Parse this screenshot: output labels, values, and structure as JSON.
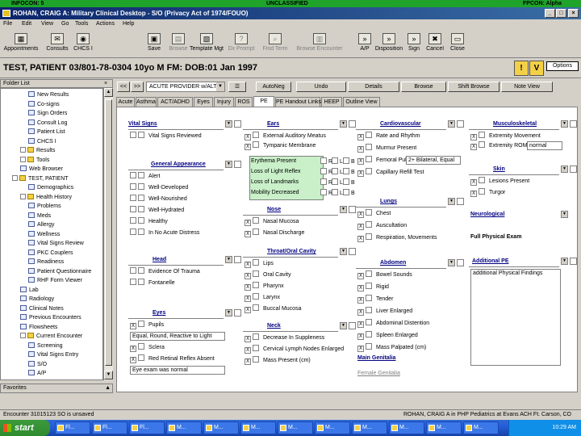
{
  "classification": {
    "left": "INFOCON: 5",
    "center": "UNCLASSIFIED",
    "right": "FPCON: Alpha"
  },
  "window": {
    "title": "ROHAN, CRAIG A: Military Clinical Desktop - S/O (Privacy Act of 1974/FOUO)",
    "buttons": [
      "_",
      "□",
      "×"
    ]
  },
  "menu": [
    "File",
    "Edit",
    "View",
    "Go",
    "Tools",
    "Actions",
    "Help"
  ],
  "toolbar": {
    "left": [
      {
        "label": "Appointments",
        "icon": "calendar-icon"
      },
      {
        "label": "Consults",
        "icon": "consult-icon"
      },
      {
        "label": "CHCS I",
        "icon": "chcs-icon"
      }
    ],
    "right": [
      {
        "label": "Save",
        "icon": "save-icon",
        "enabled": true
      },
      {
        "label": "Browse",
        "icon": "browse-icon",
        "enabled": false
      },
      {
        "label": "Template Mgt",
        "icon": "template-icon",
        "enabled": true
      },
      {
        "label": "Dx Prompt",
        "icon": "dx-icon",
        "enabled": false
      },
      {
        "label": "Find Term",
        "icon": "find-icon",
        "enabled": false
      },
      {
        "label": "Browse Encounter",
        "icon": "browse-encounter-icon",
        "enabled": false
      },
      {
        "label": "A/P",
        "icon": "ap-icon",
        "enabled": true
      },
      {
        "label": "Disposition",
        "icon": "disposition-icon",
        "enabled": true
      },
      {
        "label": "Sign",
        "icon": "sign-icon",
        "enabled": true
      },
      {
        "label": "Cancel",
        "icon": "cancel-icon",
        "enabled": true
      },
      {
        "label": "Close",
        "icon": "close-doc-icon",
        "enabled": true
      }
    ]
  },
  "patient": {
    "banner": "TEST, PATIENT 03/801-78-0304 10yo M FM: DOB:01 Jan 1997",
    "options_label": "Options"
  },
  "folder": {
    "header": "Folder List",
    "favorites": "Favorites",
    "items": [
      {
        "label": "New Results",
        "depth": 3,
        "type": "doc"
      },
      {
        "label": "Co-signs",
        "depth": 3,
        "type": "doc"
      },
      {
        "label": "Sign Orders",
        "depth": 3,
        "type": "doc"
      },
      {
        "label": "Consult Log",
        "depth": 3,
        "type": "doc"
      },
      {
        "label": "Patient List",
        "depth": 3,
        "type": "doc"
      },
      {
        "label": "CHCS I",
        "depth": 3,
        "type": "doc"
      },
      {
        "label": "Results",
        "depth": 2,
        "type": "fold"
      },
      {
        "label": "Tools",
        "depth": 2,
        "type": "fold"
      },
      {
        "label": "Web Browser",
        "depth": 2,
        "type": "doc"
      },
      {
        "label": "TEST, PATIENT",
        "depth": 1,
        "type": "fold"
      },
      {
        "label": "Demographics",
        "depth": 3,
        "type": "doc"
      },
      {
        "label": "Health History",
        "depth": 2,
        "type": "fold"
      },
      {
        "label": "Problems",
        "depth": 3,
        "type": "doc"
      },
      {
        "label": "Meds",
        "depth": 3,
        "type": "doc"
      },
      {
        "label": "Allergy",
        "depth": 3,
        "type": "doc"
      },
      {
        "label": "Wellness",
        "depth": 3,
        "type": "doc"
      },
      {
        "label": "Vital Signs Review",
        "depth": 3,
        "type": "doc"
      },
      {
        "label": "PKC Couplers",
        "depth": 3,
        "type": "doc"
      },
      {
        "label": "Readiness",
        "depth": 3,
        "type": "doc"
      },
      {
        "label": "Patient Questionnaire",
        "depth": 3,
        "type": "doc"
      },
      {
        "label": "RHF Form Viewer",
        "depth": 3,
        "type": "doc"
      },
      {
        "label": "Lab",
        "depth": 2,
        "type": "doc"
      },
      {
        "label": "Radiology",
        "depth": 2,
        "type": "doc"
      },
      {
        "label": "Clinical Notes",
        "depth": 2,
        "type": "doc"
      },
      {
        "label": "Previous Encounters",
        "depth": 2,
        "type": "doc"
      },
      {
        "label": "Flowsheets",
        "depth": 2,
        "type": "doc"
      },
      {
        "label": "Current Encounter",
        "depth": 2,
        "type": "fold"
      },
      {
        "label": "Screening",
        "depth": 3,
        "type": "doc"
      },
      {
        "label": "Vital Signs Entry",
        "depth": 3,
        "type": "doc"
      },
      {
        "label": "S/O",
        "depth": 3,
        "type": "doc"
      },
      {
        "label": "A/P",
        "depth": 3,
        "type": "doc"
      }
    ]
  },
  "nav": {
    "back": "<<",
    "fwd": ">>",
    "provider": "ACUTE PROVIDER w/ALT",
    "autoneg": "AutoNeg",
    "undo": "Undo",
    "details": "Details",
    "browse": "Browse",
    "shift_browse": "Shift Browse",
    "note_view": "Note View"
  },
  "tabs": [
    {
      "label": "Acute",
      "active": false
    },
    {
      "label": "Asthma",
      "active": false
    },
    {
      "label": "ACT/ADHD",
      "active": false
    },
    {
      "label": "Eyes",
      "active": false
    },
    {
      "label": "Injury",
      "active": false
    },
    {
      "label": "ROS",
      "active": false
    },
    {
      "label": "PE",
      "active": true
    },
    {
      "label": "PE Handout Links",
      "active": false
    },
    {
      "label": "HEEP",
      "active": false
    },
    {
      "label": "Outline View",
      "active": false
    }
  ],
  "sections": {
    "vital_signs": {
      "title": "Vital Signs",
      "items": [
        "Vital Signs Reviewed"
      ]
    },
    "general_appearance": {
      "title": "General Appearance",
      "items": [
        "Alert",
        "Well-Developed",
        "Well-Nourished",
        "Well-Hydrated",
        "Healthy",
        "In No Acute Distress"
      ]
    },
    "head": {
      "title": "Head",
      "items": [
        "Evidence Of Trauma",
        "Fontanelle"
      ]
    },
    "eyes": {
      "title": "Eyes",
      "items": [
        "Pupils",
        "Sclera",
        "Red Retinal Reflex Absent"
      ],
      "memo1": "Equal, Round, Reactive to Light",
      "memo2": "Eye exam was normal"
    },
    "ears": {
      "title": "Ears",
      "items": [
        "External Auditory Meatus",
        "Tympanic Membrane"
      ],
      "sub": [
        "Erythema Present",
        "Loss of Light Reflex",
        "Loss of Landmarks",
        "Mobility Decreased"
      ],
      "sub_cols": [
        "R",
        "L",
        "B"
      ]
    },
    "nose": {
      "title": "Nose",
      "items": [
        "Nasal Mucosa",
        "Nasal Discharge"
      ]
    },
    "throat": {
      "title": "Throat/Oral Cavity",
      "items": [
        "Lips",
        "Oral Cavity",
        "Pharynx",
        "Larynx",
        "Buccal Mucosa"
      ]
    },
    "neck": {
      "title": "Neck",
      "items": [
        "Decrease In Suppleness",
        "Cervical Lymph Nodes Enlarged",
        "Mass Present (cm)"
      ]
    },
    "cardiovascular": {
      "title": "Cardiovascular",
      "items": [
        "Rate and Rhythm",
        "Murmur Present",
        "Femoral Pulse",
        "Capillary Refill Test"
      ],
      "femoral_value": "2+ Bilateral, Equal"
    },
    "lungs": {
      "title": "Lungs",
      "items": [
        "Chest",
        "Auscultation",
        "Respiration, Movements"
      ]
    },
    "abdomen": {
      "title": "Abdomen",
      "items": [
        "Bowel Sounds",
        "Rigid",
        "Tender",
        "Liver Enlarged",
        "Abdominal Distention",
        "Spleen Enlarged",
        "Mass Palpated (cm)"
      ]
    },
    "main_genitalia": {
      "title": "Main Genitalia"
    },
    "female_genitalia": {
      "title": "Female Genitalia"
    },
    "musculoskeletal": {
      "title": "Musculoskeletal",
      "items": [
        "Extremity Movement",
        "Extremity ROM"
      ],
      "rom_value": "normal"
    },
    "skin": {
      "title": "Skin",
      "items": [
        "Lesions Present",
        "Turgor"
      ]
    },
    "neurological": {
      "title": "Neurological"
    },
    "full_physical": {
      "title": "Full Physical Exam"
    },
    "additional_pe": {
      "title": "Additional PE",
      "memo": "additional Physical Findings"
    }
  },
  "status": {
    "left": "Encounter 31015123 SO is unsaved",
    "right": "ROHAN, CRAIG A in PHP Pediatrics at Evans ACH Ft. Carson, CO"
  },
  "taskbar": {
    "start": "start",
    "tasks": [
      "Fl...",
      "Fl...",
      "Fl...",
      "M...",
      "M...",
      "M...",
      "M...",
      "M...",
      "M...",
      "M...",
      "M...",
      "M..."
    ],
    "clock": "10:29 AM"
  }
}
